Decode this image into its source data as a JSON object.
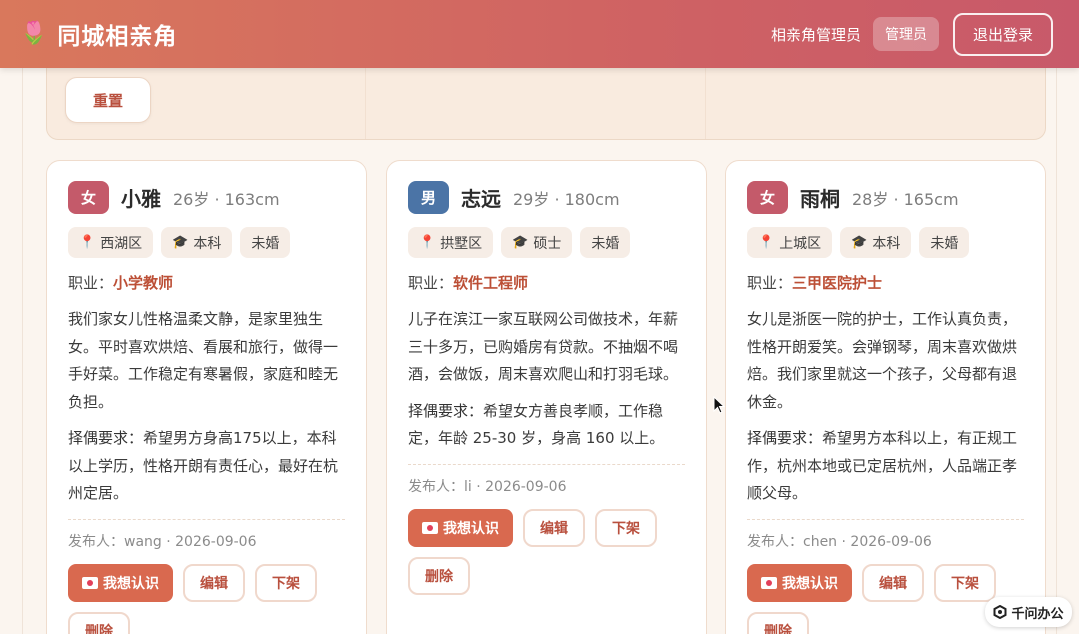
{
  "header": {
    "brand_icon": "🌷",
    "title": "同城相亲角",
    "user_name": "相亲角管理员",
    "role": "管理员",
    "logout": "退出登录"
  },
  "filter": {
    "reset": "重置"
  },
  "colors": {
    "female_badge": "#c45a6a",
    "male_badge": "#4b74a6",
    "accent": "#d9694f"
  },
  "cards": [
    {
      "gender": "女",
      "name": "小雅",
      "meta": "26岁 · 163cm",
      "tags": [
        "西湖区",
        "本科",
        "未婚"
      ],
      "job_label": "职业：",
      "job": "小学教师",
      "desc": "我们家女儿性格温柔文静，是家里独生女。平时喜欢烘焙、看展和旅行，做得一手好菜。工作稳定有寒暑假，家庭和睦无负担。",
      "req_label": "择偶要求：",
      "req": "希望男方身高175以上，本科以上学历，性格开朗有责任心，最好在杭州定居。",
      "publisher": "发布人：wang · 2026-09-06",
      "actions": {
        "meet": "我想认识",
        "edit": "编辑",
        "offline": "下架",
        "delete": "删除"
      }
    },
    {
      "gender": "男",
      "name": "志远",
      "meta": "29岁 · 180cm",
      "tags": [
        "拱墅区",
        "硕士",
        "未婚"
      ],
      "job_label": "职业：",
      "job": "软件工程师",
      "desc": "儿子在滨江一家互联网公司做技术，年薪三十多万，已购婚房有贷款。不抽烟不喝酒，会做饭，周末喜欢爬山和打羽毛球。",
      "req_label": "择偶要求：",
      "req": "希望女方善良孝顺，工作稳定，年龄 25-30 岁，身高 160 以上。",
      "publisher": "发布人：li · 2026-09-06",
      "actions": {
        "meet": "我想认识",
        "edit": "编辑",
        "offline": "下架",
        "delete": "删除"
      }
    },
    {
      "gender": "女",
      "name": "雨桐",
      "meta": "28岁 · 165cm",
      "tags": [
        "上城区",
        "本科",
        "未婚"
      ],
      "job_label": "职业：",
      "job": "三甲医院护士",
      "desc": "女儿是浙医一院的护士，工作认真负责，性格开朗爱笑。会弹钢琴，周末喜欢做烘焙。我们家里就这一个孩子，父母都有退休金。",
      "req_label": "择偶要求：",
      "req": "希望男方本科以上，有正规工作，杭州本地或已定居杭州，人品端正孝顺父母。",
      "publisher": "发布人：chen · 2026-09-06",
      "actions": {
        "meet": "我想认识",
        "edit": "编辑",
        "offline": "下架",
        "delete": "删除"
      }
    }
  ],
  "watermark": "千问办公"
}
